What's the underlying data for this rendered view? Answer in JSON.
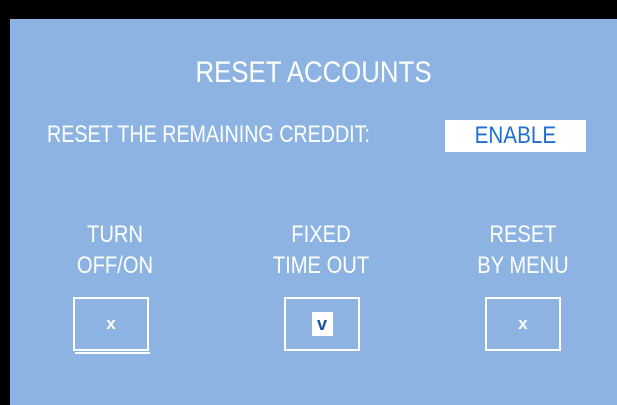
{
  "screen": {
    "title": "RESET ACCOUNTS",
    "setting": {
      "label": "RESET THE REMAINING CREDDIT:",
      "value": "ENABLE"
    },
    "options": [
      {
        "line1": "TURN",
        "line2": "OFF/ON",
        "mark": "x",
        "selected": false
      },
      {
        "line1": "FIXED",
        "line2": "TIME OUT",
        "mark": "v",
        "selected": true
      },
      {
        "line1": "RESET",
        "line2": "BY MENU",
        "mark": "x",
        "selected": false
      }
    ]
  },
  "colors": {
    "background": "#8db3e2",
    "frame": "#000000",
    "text": "#ffffff",
    "value_text": "#1f6ed4"
  }
}
